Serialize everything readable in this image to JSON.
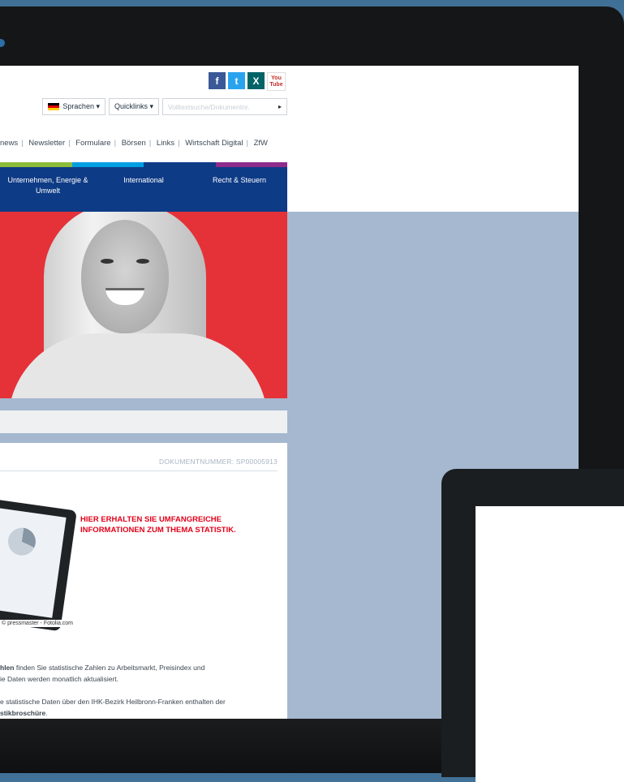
{
  "social": {
    "facebook": "f",
    "twitter": "t",
    "xing": "X",
    "youtube_line1": "You",
    "youtube_line2": "Tube"
  },
  "toolbar": {
    "language_label": "Sprachen ▾",
    "quicklinks_label": "Quicklinks ▾",
    "search_placeholder": "Volltextsuche/Dokumentnr.",
    "search_button": "▸"
  },
  "quicknav": {
    "items": [
      "news",
      "Newsletter",
      "Formulare",
      "Börsen",
      "Links",
      "Wirtschaft Digital",
      "ZfW"
    ]
  },
  "colors": {
    "bar": [
      "#8dbb3a",
      "#009fe3",
      "#0e3b86",
      "#8e2b8c"
    ],
    "nav_bg": "#0e3b86",
    "hero_bg": "#e53238",
    "headline": "#e2001a"
  },
  "mainnav": {
    "items": [
      "Unternehmen, Energie & Umwelt",
      "International",
      "Recht & Steuern"
    ]
  },
  "document": {
    "number_label": "DOKUMENTNUMMER: SP00005913",
    "headline": "HIER ERHALTEN SIE UMFANGREICHE INFORMATIONEN ZUM THEMA STATISTIK.",
    "photo_credit": "© pressmaster - Fotolia.com",
    "p1_bold": "hlen",
    "p1_text": " finden Sie statistische Zahlen zu Arbeitsmarkt, Preisindex und",
    "p1_line2": "ie Daten werden monatlich aktualisiert.",
    "p2_text": "e statistische Daten über den IHK-Bezirk Heilbronn-Franken enthalten der",
    "p2_bold": "stikbroschüre",
    "p2_end": "."
  }
}
